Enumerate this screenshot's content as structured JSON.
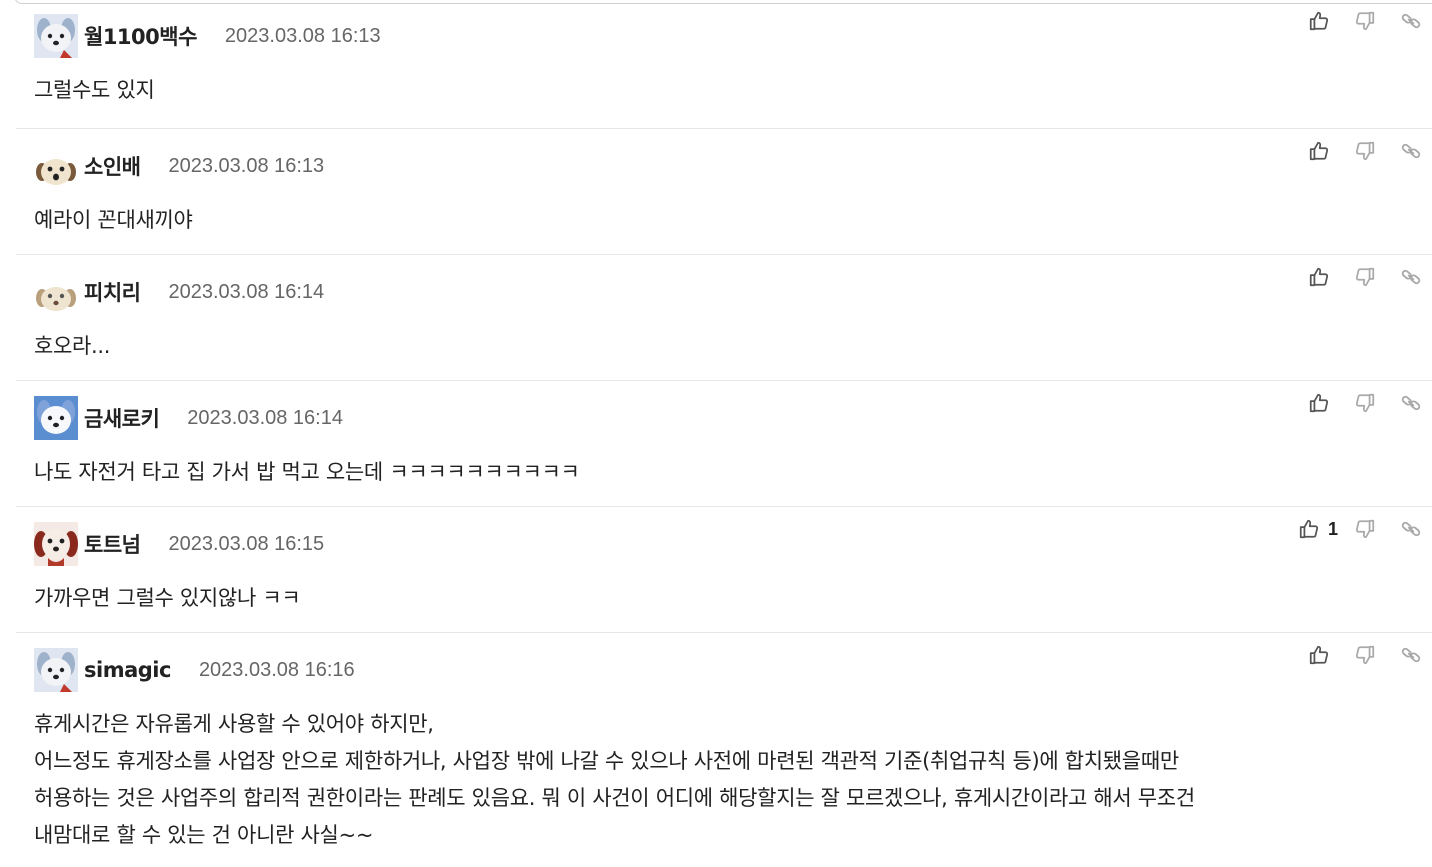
{
  "comments": [
    {
      "nick": "월1100백수",
      "date": "2023.03.08 16:13",
      "lines": [
        "그럴수도 있지"
      ],
      "likes": "",
      "avatar": "white-dog"
    },
    {
      "nick": "소인배",
      "date": "2023.03.08 16:13",
      "lines": [
        "예라이 꼰대새끼야"
      ],
      "likes": "",
      "avatar": "puppy-face"
    },
    {
      "nick": "피치리",
      "date": "2023.03.08 16:14",
      "lines": [
        "호오라..."
      ],
      "likes": "",
      "avatar": "puppy-face-light"
    },
    {
      "nick": "금새로키",
      "date": "2023.03.08 16:14",
      "lines": [
        "나도 자전거 타고 집 가서 밥 먹고 오는데 ㅋㅋㅋㅋㅋㅋㅋㅋㅋㅋ"
      ],
      "likes": "",
      "avatar": "white-dog-blue"
    },
    {
      "nick": "토트넘",
      "date": "2023.03.08 16:15",
      "lines": [
        "가까우면 그럴수 있지않나 ㅋㅋ"
      ],
      "likes": "1",
      "avatar": "puppy-red"
    },
    {
      "nick": "simagic",
      "date": "2023.03.08 16:16",
      "lines": [
        "휴게시간은 자유롭게 사용할 수 있어야 하지만,",
        "어느정도 휴게장소를 사업장 안으로 제한하거나, 사업장 밖에 나갈 수 있으나 사전에 마련된 객관적 기준(취업규칙 등)에 합치됐을때만",
        "허용하는 것은 사업주의 합리적 권한이라는 판례도 있음요. 뭐 이 사건이 어디에 해당할지는 잘 모르겠으나, 휴게시간이라고 해서 무조건",
        "내맘대로 할 수 있는 건 아니란 사실~~"
      ],
      "likes": "",
      "avatar": "white-dog"
    }
  ],
  "icons": {
    "like": "thumbs-up-icon",
    "dislike": "thumbs-down-icon",
    "link": "link-icon"
  },
  "colors": {
    "text": "#222222",
    "date": "#666666",
    "divider": "#e6e6e6",
    "icon": "#555555",
    "icon_muted": "#a9a9a9"
  }
}
